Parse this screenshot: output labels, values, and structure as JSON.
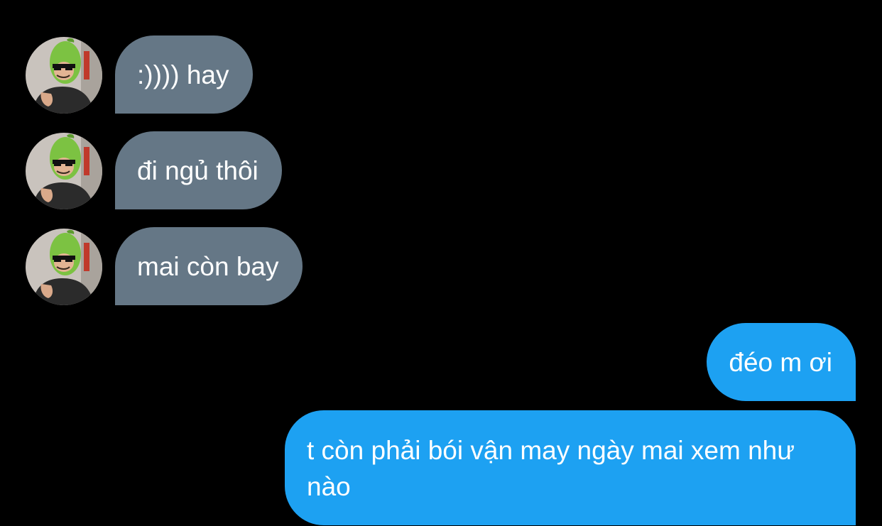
{
  "colors": {
    "background": "#000000",
    "incoming_bubble": "#657786",
    "outgoing_bubble": "#1da1f2",
    "text": "#ffffff"
  },
  "contact": {
    "avatar_icon": "avatar-photo-green-pear-hat"
  },
  "messages": [
    {
      "direction": "incoming",
      "text": ":)))) hay"
    },
    {
      "direction": "incoming",
      "text": "đi ngủ thôi"
    },
    {
      "direction": "incoming",
      "text": "mai còn bay"
    },
    {
      "direction": "outgoing",
      "text": "đéo m ơi"
    },
    {
      "direction": "outgoing",
      "text": "t còn phải bói vận may ngày mai xem như nào"
    }
  ]
}
